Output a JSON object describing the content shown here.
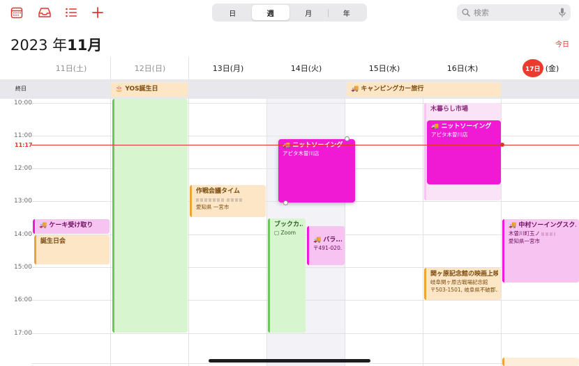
{
  "toolbar": {
    "view_tabs": [
      "日",
      "週",
      "月",
      "年"
    ],
    "active_tab": 1,
    "search_placeholder": "検索"
  },
  "header": {
    "year": "2023 年",
    "month": "11月",
    "today_label": "今日"
  },
  "days": [
    {
      "label": "11日(土)"
    },
    {
      "label": "12日(日)"
    },
    {
      "label": "13日(月)"
    },
    {
      "label": "14日(火)"
    },
    {
      "label": "15日(水)"
    },
    {
      "label": "16日(木)"
    },
    {
      "day_num": "17日",
      "weekday": "(金)"
    }
  ],
  "allday": {
    "label": "終日",
    "events": [
      {
        "title": "🎂 YOS誕生日"
      },
      {
        "title": "🚚 キャンピングカー旅行"
      }
    ]
  },
  "hours": [
    "10:00",
    "11:00",
    "12:00",
    "13:00",
    "14:00",
    "15:00",
    "16:00",
    "17:00"
  ],
  "now_label": "11:17",
  "events": {
    "cake": {
      "title": "🚚 ケーキ受け取り"
    },
    "birthday_party": {
      "title": "誕生日会"
    },
    "strategy": {
      "title": "作戦会議タイム",
      "line2": "愛知県 一宮市"
    },
    "book": {
      "title": "ブックカ...",
      "line1": "▢ Zoom"
    },
    "knit_tue": {
      "title": "🚚 ニットソーイング",
      "line1": "アピタ木曽川店"
    },
    "bara": {
      "title": "🚚 バラ...",
      "line1": "〒491-020..."
    },
    "market": {
      "title": "木暮らし市場"
    },
    "knit_thu": {
      "title": "🚚 ニットソーイング",
      "line1": "アピタ木曽川店"
    },
    "sekigahara": {
      "title": "関ヶ原記念館の映画上映",
      "line1": "岐阜関ヶ原古戦場記念館",
      "line2": "〒503-1501, 岐阜県不破郡..."
    },
    "nakamura": {
      "title": "🚚 中村ソーイングスク...",
      "line1": "木曽川町玉ノ",
      "line2": "愛知県一宮市"
    }
  },
  "colors": {
    "accent": "#e0332c",
    "magenta": "#f019d4",
    "pink_light": "#f7c3f0",
    "green_light": "#d7f5cf",
    "green": "#6bc95a",
    "orange_light": "#fde6c6",
    "orange": "#f0a23a"
  }
}
